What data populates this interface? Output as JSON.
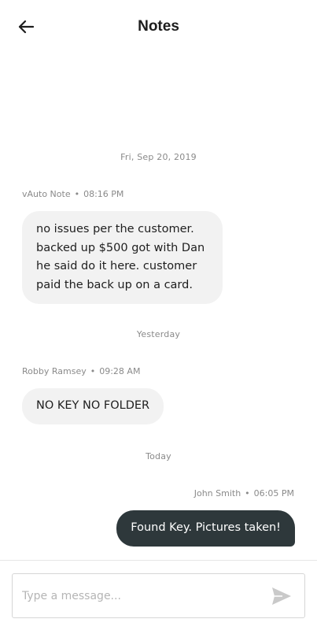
{
  "header": {
    "title": "Notes",
    "back_icon": "arrow-left-icon"
  },
  "thread": [
    {
      "date": "Fri, Sep 20, 2019",
      "messages": [
        {
          "author": "vAuto Note",
          "time": "08:16 PM",
          "text": "no issues per the customer. backed up $500 got with Dan he said do it here. customer paid the back up on a card.",
          "direction": "incoming"
        }
      ]
    },
    {
      "date": "Yesterday",
      "messages": [
        {
          "author": "Robby Ramsey",
          "time": "09:28 AM",
          "text": "NO KEY NO FOLDER",
          "direction": "incoming"
        }
      ]
    },
    {
      "date": "Today",
      "messages": [
        {
          "author": "John Smith",
          "time": "06:05 PM",
          "text": "Found Key. Pictures taken!",
          "direction": "outgoing"
        }
      ]
    }
  ],
  "meta_separator": "•",
  "composer": {
    "placeholder": "Type a message...",
    "value": "",
    "send_icon": "send-icon"
  },
  "colors": {
    "incoming_bubble": "#f2f2f2",
    "outgoing_bubble": "#2e383b",
    "meta_text": "#8a8a8a"
  }
}
